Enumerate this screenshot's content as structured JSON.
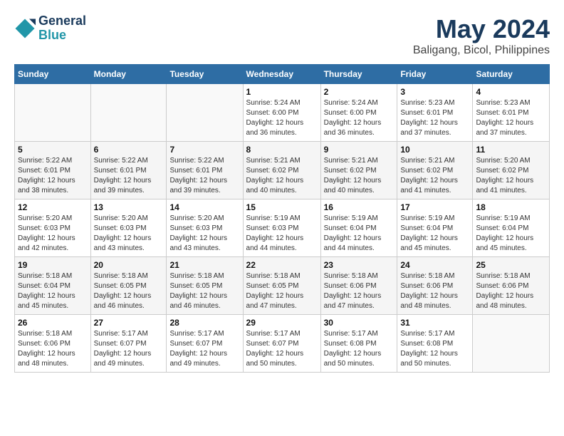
{
  "header": {
    "logo_line1": "General",
    "logo_line2": "Blue",
    "month_year": "May 2024",
    "location": "Baligang, Bicol, Philippines"
  },
  "days_of_week": [
    "Sunday",
    "Monday",
    "Tuesday",
    "Wednesday",
    "Thursday",
    "Friday",
    "Saturday"
  ],
  "weeks": [
    [
      {
        "num": "",
        "info": ""
      },
      {
        "num": "",
        "info": ""
      },
      {
        "num": "",
        "info": ""
      },
      {
        "num": "1",
        "info": "Sunrise: 5:24 AM\nSunset: 6:00 PM\nDaylight: 12 hours\nand 36 minutes."
      },
      {
        "num": "2",
        "info": "Sunrise: 5:24 AM\nSunset: 6:00 PM\nDaylight: 12 hours\nand 36 minutes."
      },
      {
        "num": "3",
        "info": "Sunrise: 5:23 AM\nSunset: 6:01 PM\nDaylight: 12 hours\nand 37 minutes."
      },
      {
        "num": "4",
        "info": "Sunrise: 5:23 AM\nSunset: 6:01 PM\nDaylight: 12 hours\nand 37 minutes."
      }
    ],
    [
      {
        "num": "5",
        "info": "Sunrise: 5:22 AM\nSunset: 6:01 PM\nDaylight: 12 hours\nand 38 minutes."
      },
      {
        "num": "6",
        "info": "Sunrise: 5:22 AM\nSunset: 6:01 PM\nDaylight: 12 hours\nand 39 minutes."
      },
      {
        "num": "7",
        "info": "Sunrise: 5:22 AM\nSunset: 6:01 PM\nDaylight: 12 hours\nand 39 minutes."
      },
      {
        "num": "8",
        "info": "Sunrise: 5:21 AM\nSunset: 6:02 PM\nDaylight: 12 hours\nand 40 minutes."
      },
      {
        "num": "9",
        "info": "Sunrise: 5:21 AM\nSunset: 6:02 PM\nDaylight: 12 hours\nand 40 minutes."
      },
      {
        "num": "10",
        "info": "Sunrise: 5:21 AM\nSunset: 6:02 PM\nDaylight: 12 hours\nand 41 minutes."
      },
      {
        "num": "11",
        "info": "Sunrise: 5:20 AM\nSunset: 6:02 PM\nDaylight: 12 hours\nand 41 minutes."
      }
    ],
    [
      {
        "num": "12",
        "info": "Sunrise: 5:20 AM\nSunset: 6:03 PM\nDaylight: 12 hours\nand 42 minutes."
      },
      {
        "num": "13",
        "info": "Sunrise: 5:20 AM\nSunset: 6:03 PM\nDaylight: 12 hours\nand 43 minutes."
      },
      {
        "num": "14",
        "info": "Sunrise: 5:20 AM\nSunset: 6:03 PM\nDaylight: 12 hours\nand 43 minutes."
      },
      {
        "num": "15",
        "info": "Sunrise: 5:19 AM\nSunset: 6:03 PM\nDaylight: 12 hours\nand 44 minutes."
      },
      {
        "num": "16",
        "info": "Sunrise: 5:19 AM\nSunset: 6:04 PM\nDaylight: 12 hours\nand 44 minutes."
      },
      {
        "num": "17",
        "info": "Sunrise: 5:19 AM\nSunset: 6:04 PM\nDaylight: 12 hours\nand 45 minutes."
      },
      {
        "num": "18",
        "info": "Sunrise: 5:19 AM\nSunset: 6:04 PM\nDaylight: 12 hours\nand 45 minutes."
      }
    ],
    [
      {
        "num": "19",
        "info": "Sunrise: 5:18 AM\nSunset: 6:04 PM\nDaylight: 12 hours\nand 45 minutes."
      },
      {
        "num": "20",
        "info": "Sunrise: 5:18 AM\nSunset: 6:05 PM\nDaylight: 12 hours\nand 46 minutes."
      },
      {
        "num": "21",
        "info": "Sunrise: 5:18 AM\nSunset: 6:05 PM\nDaylight: 12 hours\nand 46 minutes."
      },
      {
        "num": "22",
        "info": "Sunrise: 5:18 AM\nSunset: 6:05 PM\nDaylight: 12 hours\nand 47 minutes."
      },
      {
        "num": "23",
        "info": "Sunrise: 5:18 AM\nSunset: 6:06 PM\nDaylight: 12 hours\nand 47 minutes."
      },
      {
        "num": "24",
        "info": "Sunrise: 5:18 AM\nSunset: 6:06 PM\nDaylight: 12 hours\nand 48 minutes."
      },
      {
        "num": "25",
        "info": "Sunrise: 5:18 AM\nSunset: 6:06 PM\nDaylight: 12 hours\nand 48 minutes."
      }
    ],
    [
      {
        "num": "26",
        "info": "Sunrise: 5:18 AM\nSunset: 6:06 PM\nDaylight: 12 hours\nand 48 minutes."
      },
      {
        "num": "27",
        "info": "Sunrise: 5:17 AM\nSunset: 6:07 PM\nDaylight: 12 hours\nand 49 minutes."
      },
      {
        "num": "28",
        "info": "Sunrise: 5:17 AM\nSunset: 6:07 PM\nDaylight: 12 hours\nand 49 minutes."
      },
      {
        "num": "29",
        "info": "Sunrise: 5:17 AM\nSunset: 6:07 PM\nDaylight: 12 hours\nand 50 minutes."
      },
      {
        "num": "30",
        "info": "Sunrise: 5:17 AM\nSunset: 6:08 PM\nDaylight: 12 hours\nand 50 minutes."
      },
      {
        "num": "31",
        "info": "Sunrise: 5:17 AM\nSunset: 6:08 PM\nDaylight: 12 hours\nand 50 minutes."
      },
      {
        "num": "",
        "info": ""
      }
    ]
  ]
}
